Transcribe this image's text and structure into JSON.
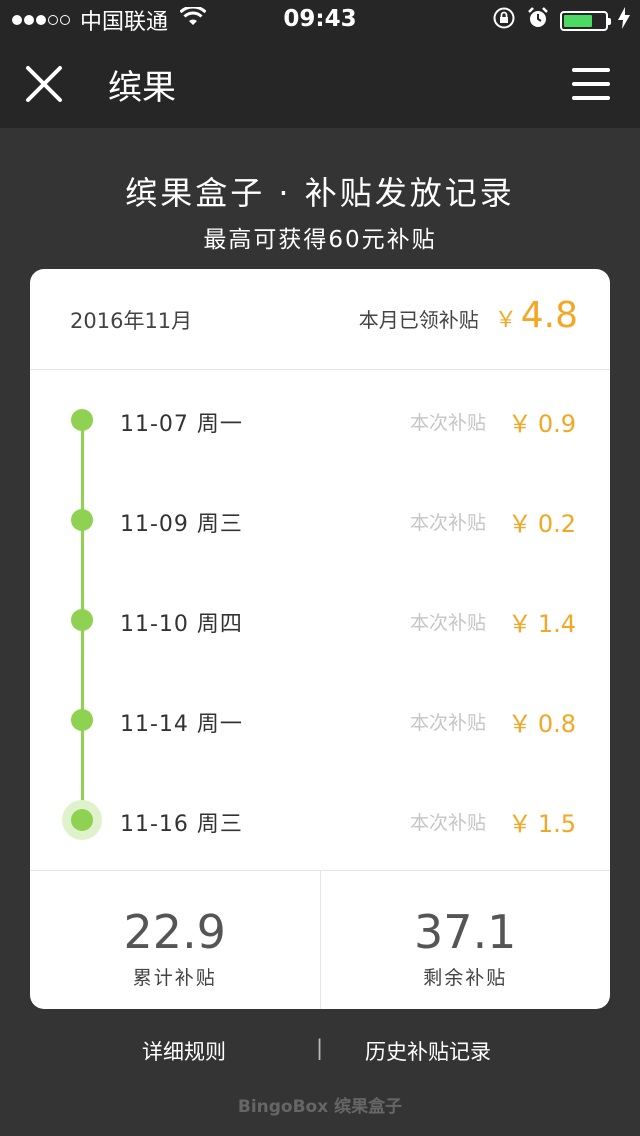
{
  "status_bar": {
    "carrier": "中国联通",
    "time": "09:43",
    "battery_percent": 70
  },
  "nav": {
    "title": "缤果",
    "close_icon": "close-icon",
    "menu_icon": "menu-icon"
  },
  "heading": {
    "title": "缤果盒子 · 补贴发放记录",
    "subtitle": "最高可获得60元补贴"
  },
  "card": {
    "month": "2016年11月",
    "month_total_label": "本月已领补贴",
    "currency": "￥",
    "month_total": "4.8",
    "items": [
      {
        "date": "11-07  周一",
        "label": "本次补贴",
        "amount": "0.9"
      },
      {
        "date": "11-09  周三",
        "label": "本次补贴",
        "amount": "0.2"
      },
      {
        "date": "11-10  周四",
        "label": "本次补贴",
        "amount": "1.4"
      },
      {
        "date": "11-14  周一",
        "label": "本次补贴",
        "amount": "0.8"
      },
      {
        "date": "11-16  周三",
        "label": "本次补贴",
        "amount": "1.5"
      }
    ],
    "stats": [
      {
        "value": "22.9",
        "label": "累计补贴"
      },
      {
        "value": "37.1",
        "label": "剩余补贴"
      }
    ]
  },
  "links": {
    "rules": "详细规则",
    "separator": "|",
    "history": "历史补贴记录"
  },
  "brand": "BingoBox 缤果盒子",
  "colors": {
    "background": "#343434",
    "accent_green": "#8fd151",
    "accent_orange": "#f5a623"
  }
}
